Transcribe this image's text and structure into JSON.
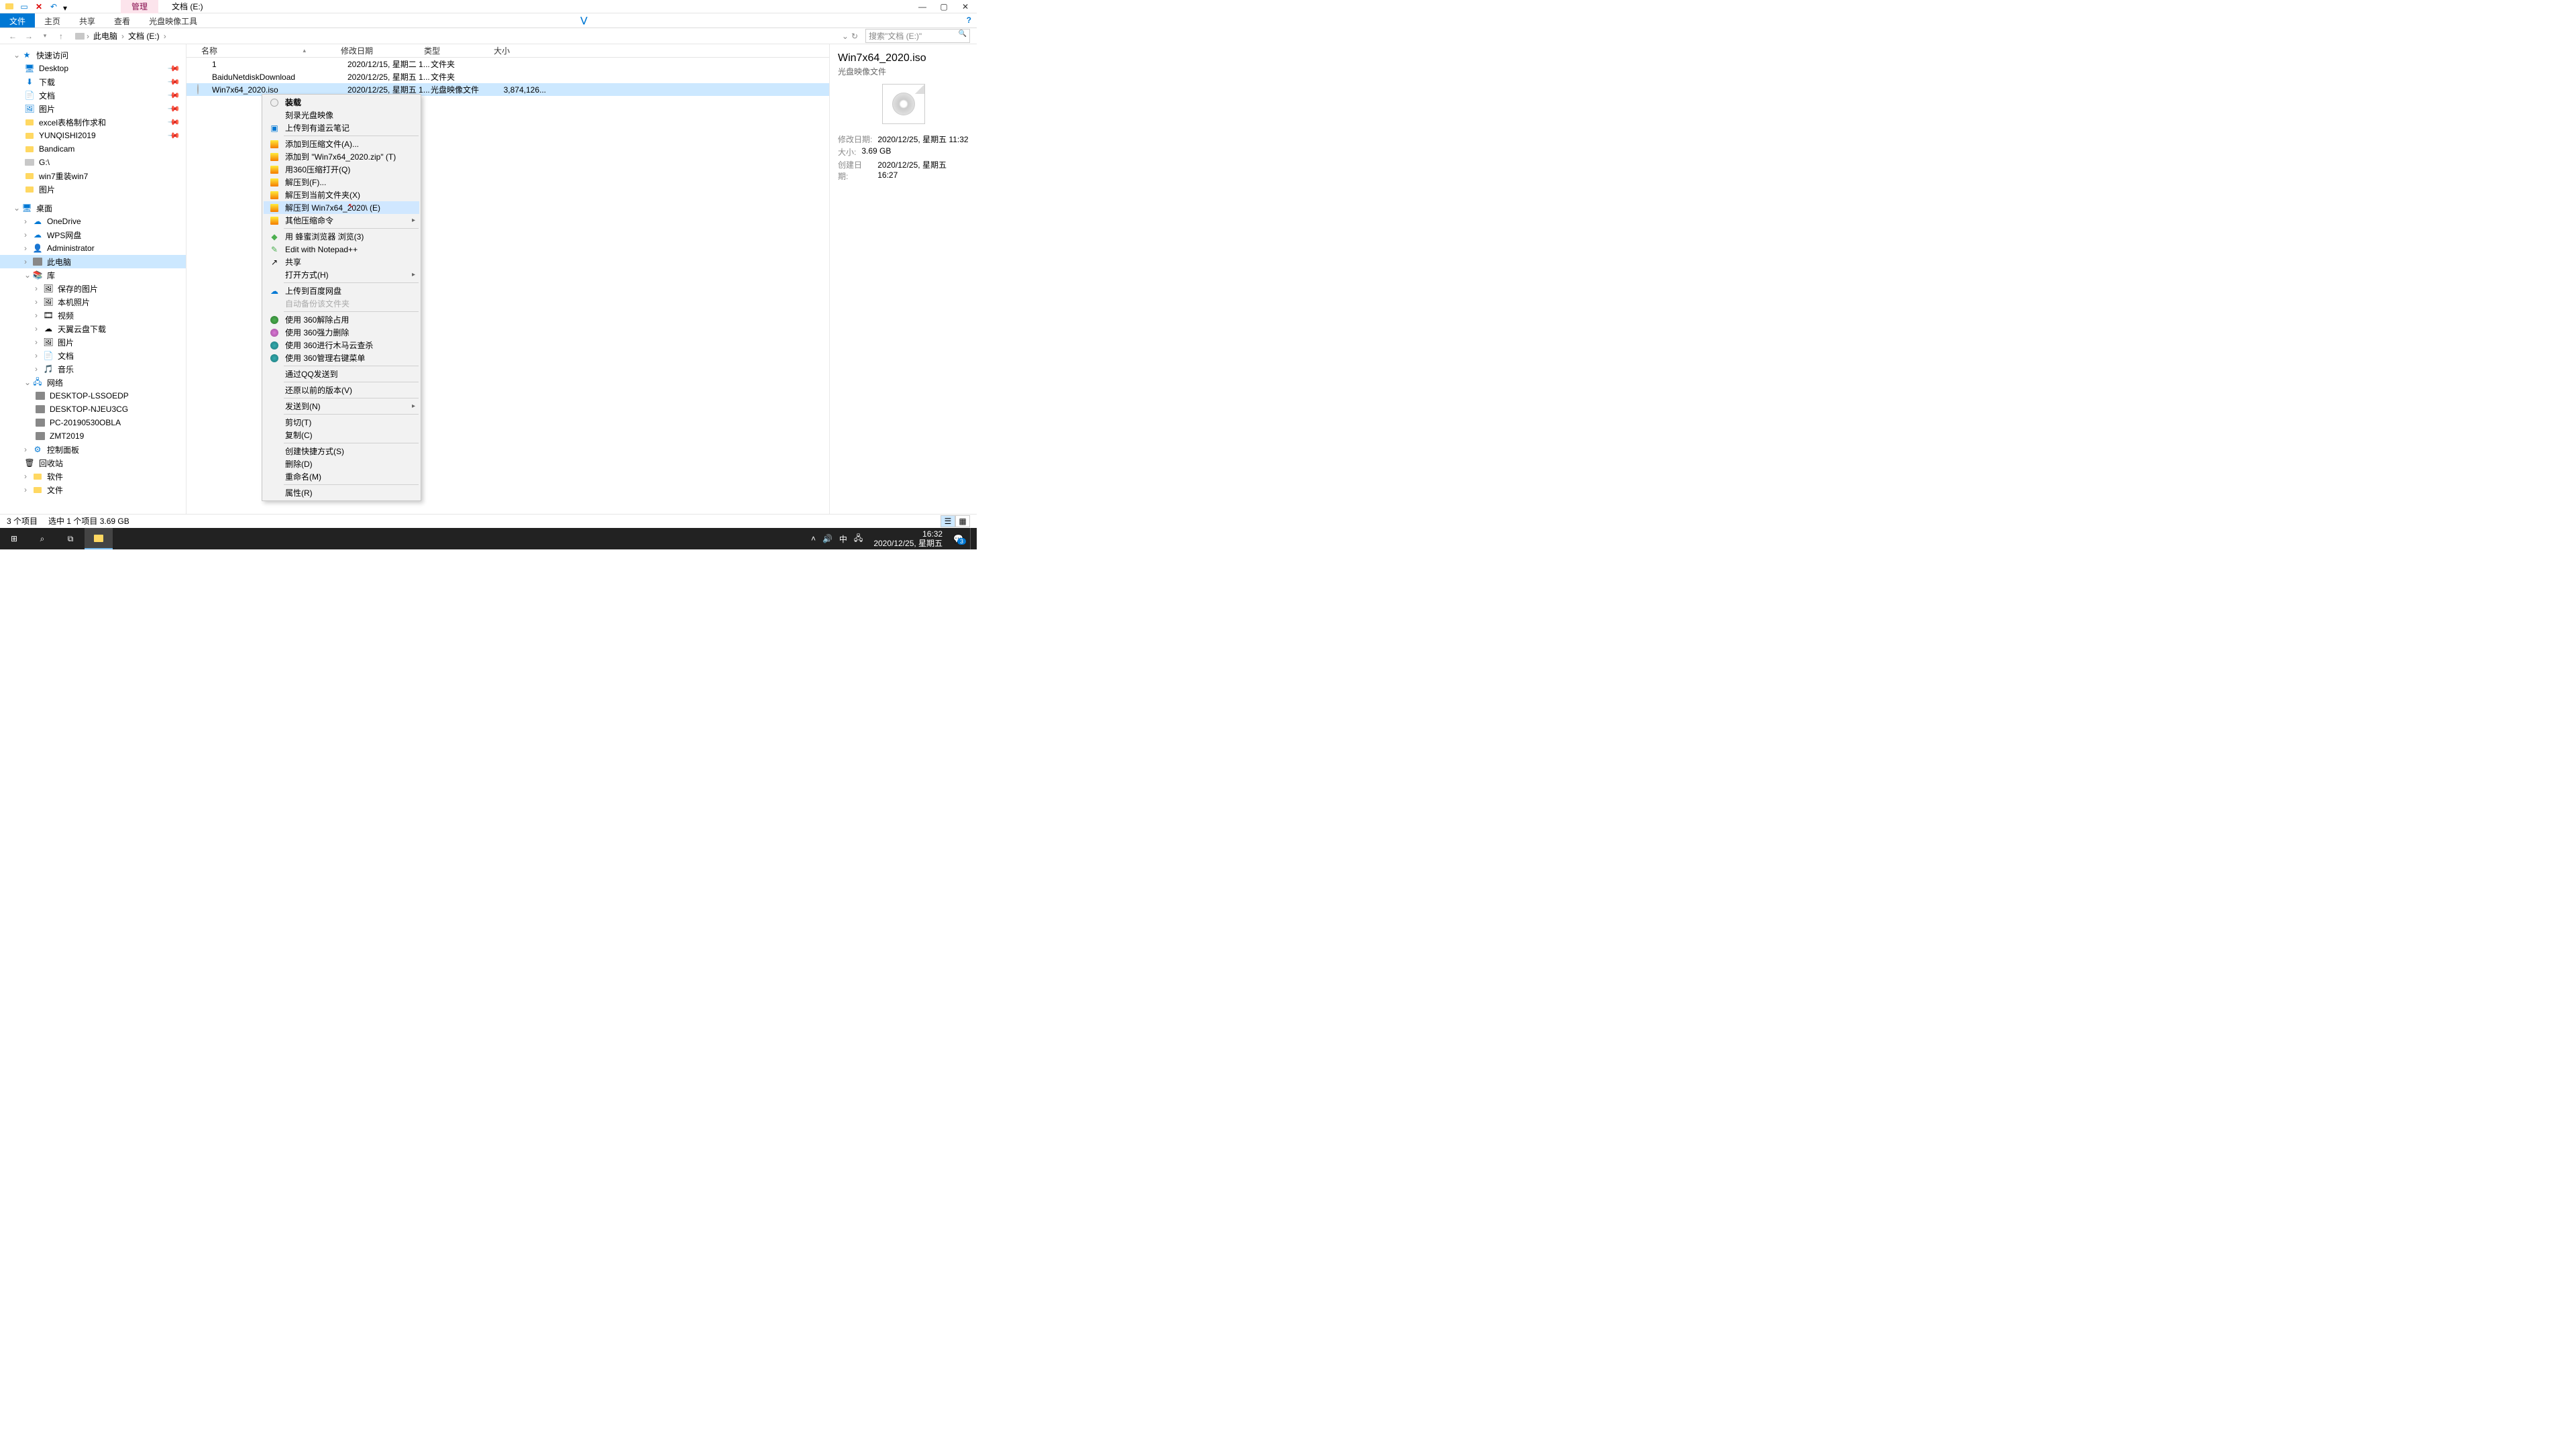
{
  "window": {
    "manage_tab": "管理",
    "title": "文档 (E:)"
  },
  "ribbon": {
    "file": "文件",
    "home": "主页",
    "share": "共享",
    "view": "查看",
    "disc_tools": "光盘映像工具"
  },
  "address": {
    "this_pc": "此电脑",
    "drive": "文档 (E:)"
  },
  "search": {
    "placeholder": "搜索\"文档 (E:)\""
  },
  "nav": {
    "quick_access": "快速访问",
    "desktop": "Desktop",
    "downloads": "下载",
    "documents": "文档",
    "pictures": "图片",
    "excel": "excel表格制作求和",
    "yunqishi": "YUNQISHI2019",
    "bandicam": "Bandicam",
    "gdrive": "G:\\",
    "win7reinstall": "win7重装win7",
    "pictures2": "图片",
    "desktop_h": "桌面",
    "onedrive": "OneDrive",
    "wps": "WPS网盘",
    "admin": "Administrator",
    "thispc": "此电脑",
    "libraries": "库",
    "saved_pics": "保存的图片",
    "camera_roll": "本机照片",
    "videos": "视频",
    "tianyi": "天翼云盘下载",
    "pictures3": "图片",
    "docs": "文档",
    "music": "音乐",
    "network": "网络",
    "pc1": "DESKTOP-LSSOEDP",
    "pc2": "DESKTOP-NJEU3CG",
    "pc3": "PC-20190530OBLA",
    "pc4": "ZMT2019",
    "control_panel": "控制面板",
    "recycle": "回收站",
    "software": "软件",
    "files": "文件"
  },
  "columns": {
    "name": "名称",
    "date": "修改日期",
    "type": "类型",
    "size": "大小"
  },
  "files": {
    "r0": {
      "name": "1",
      "date": "2020/12/15, 星期二 1...",
      "type": "文件夹",
      "size": ""
    },
    "r1": {
      "name": "BaiduNetdiskDownload",
      "date": "2020/12/25, 星期五 1...",
      "type": "文件夹",
      "size": ""
    },
    "r2": {
      "name": "Win7x64_2020.iso",
      "date": "2020/12/25, 星期五 1...",
      "type": "光盘映像文件",
      "size": "3,874,126..."
    }
  },
  "details": {
    "title": "Win7x64_2020.iso",
    "subtitle": "光盘映像文件",
    "mod_label": "修改日期:",
    "mod_value": "2020/12/25, 星期五 11:32",
    "size_label": "大小:",
    "size_value": "3.69 GB",
    "created_label": "创建日期:",
    "created_value": "2020/12/25, 星期五 16:27"
  },
  "status": {
    "count": "3 个项目",
    "selected": "选中 1 个项目  3.69 GB"
  },
  "context": {
    "mount": "装载",
    "burn": "刻录光盘映像",
    "youdao": "上传到有道云笔记",
    "add_archive": "添加到压缩文件(A)...",
    "add_zip": "添加到 \"Win7x64_2020.zip\" (T)",
    "open_360": "用360压缩打开(Q)",
    "extract_f": "解压到(F)...",
    "extract_here": "解压到当前文件夹(X)",
    "extract_to": "解压到 Win7x64_2020\\ (E)",
    "other_compress": "其他压缩命令",
    "fengmi": "用 蜂蜜浏览器 浏览(3)",
    "notepad": "Edit with Notepad++",
    "share": "共享",
    "open_with": "打开方式(H)",
    "baidu_upload": "上传到百度网盘",
    "auto_backup": "自动备份该文件夹",
    "jiechu": "使用 360解除占用",
    "qiangli": "使用 360强力删除",
    "muma": "使用 360进行木马云查杀",
    "guanli": "使用 360管理右键菜单",
    "qq_send": "通过QQ发送到",
    "restore": "还原以前的版本(V)",
    "send_to": "发送到(N)",
    "cut": "剪切(T)",
    "copy": "复制(C)",
    "shortcut": "创建快捷方式(S)",
    "delete": "删除(D)",
    "rename": "重命名(M)",
    "properties": "属性(R)"
  },
  "taskbar": {
    "time": "16:32",
    "date": "2020/12/25, 星期五",
    "ime": "中",
    "notif": "3"
  }
}
